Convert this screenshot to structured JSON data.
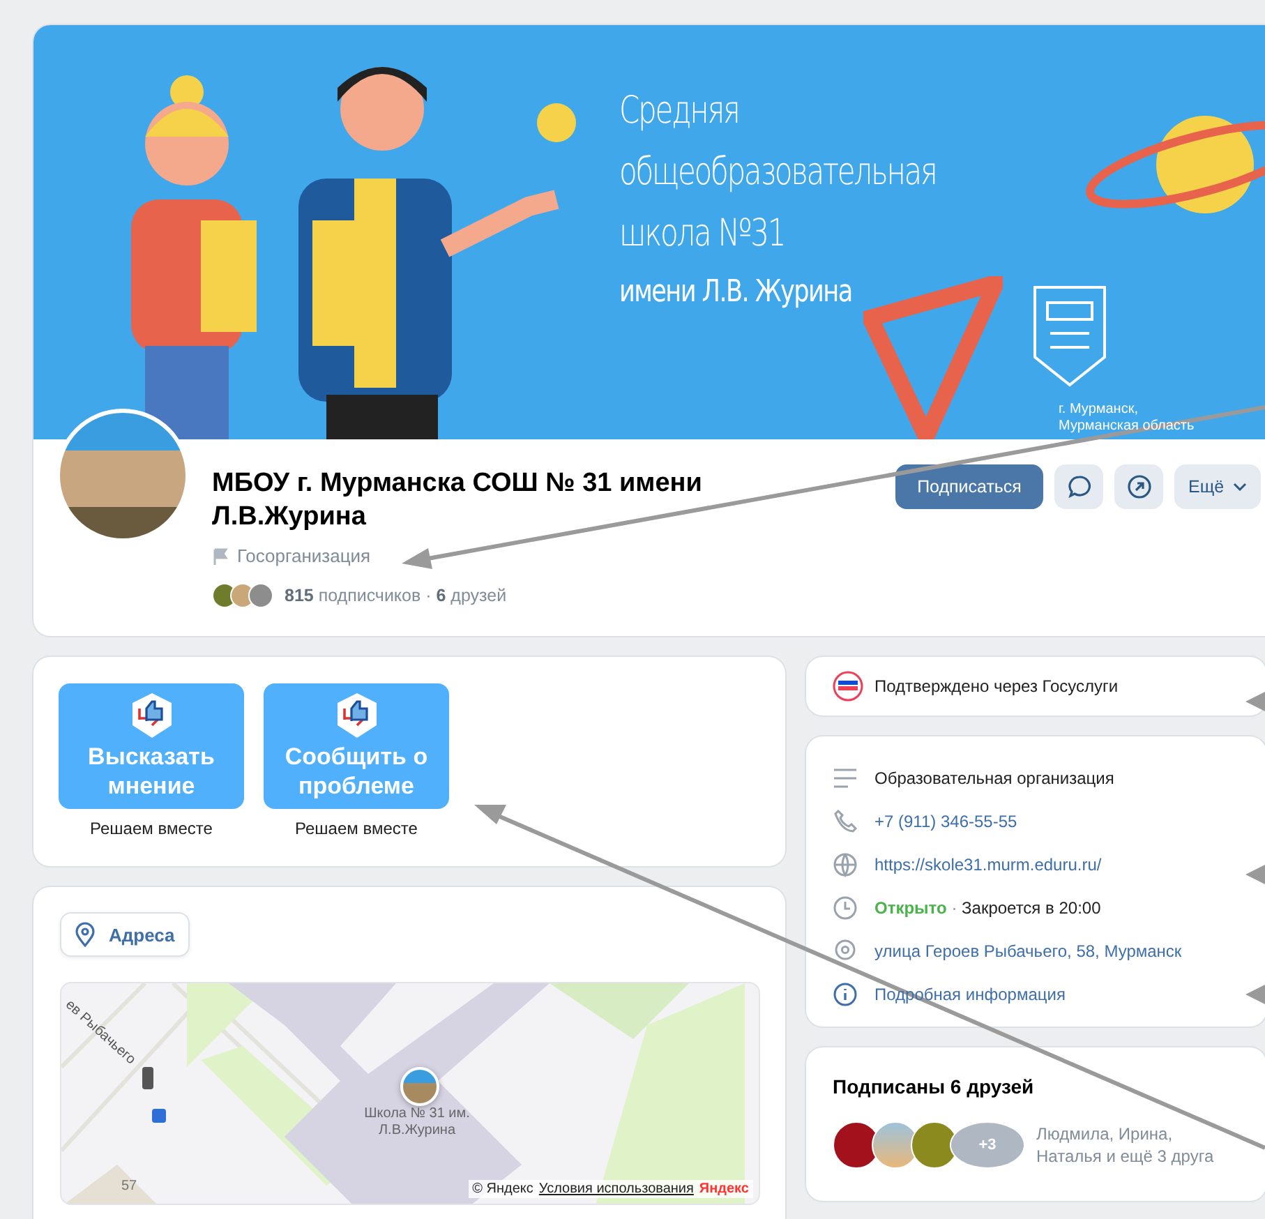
{
  "banner": {
    "title_lines": [
      "Средняя",
      "общеобразовательная",
      "школа №31"
    ],
    "subtitle": "имени Л.В. Журина",
    "location_lines": [
      "г. Мурманск,",
      "Мурманская область"
    ]
  },
  "profile": {
    "name": "МБОУ г. Мурманска СОШ № 31 имени Л.В.Журина",
    "category": "Госорганизация",
    "subscribers_count": "815",
    "subscribers_label": "подписчиков",
    "separator": "·",
    "friends_count": "6",
    "friends_label": "друзей"
  },
  "actions": [
    {
      "kind": "primary",
      "label": "Подписаться"
    },
    {
      "kind": "chat"
    },
    {
      "kind": "share"
    },
    {
      "kind": "menu",
      "label": "Ещё"
    }
  ],
  "feedback": [
    {
      "label": "Высказать мнение",
      "caption": "Решаем вместе"
    },
    {
      "label": "Сообщить о проблеме",
      "caption": "Решаем вместе"
    }
  ],
  "addresses": {
    "tab": "Адреса",
    "map": {
      "street": "ев Рыбачьего",
      "place": "Школа № 31 им. Л.В.Журина",
      "house": "57",
      "copyright": "© Яндекс",
      "terms": "Условия использования",
      "brand": "Яндекс"
    }
  },
  "verification": "Подтверждено через Госуслуги",
  "info": [
    {
      "kind": "category",
      "text": "Образовательная организация"
    },
    {
      "kind": "phone",
      "text": "+7 (911) 346-55-55"
    },
    {
      "kind": "website",
      "text": "https://skole31.murm.eduru.ru/"
    },
    {
      "kind": "hours",
      "status": "Открыто",
      "separator": "·",
      "text": "Закроется в 20:00"
    },
    {
      "kind": "address",
      "text": "улица Героев Рыбачьего, 58, Мурманск"
    },
    {
      "kind": "details",
      "text": "Подробная информация"
    }
  ],
  "friends": {
    "title": "Подписаны 6 друзей",
    "more": "+3",
    "names": "Людмила, Ирина, Наталья и ещё 3 друга"
  }
}
